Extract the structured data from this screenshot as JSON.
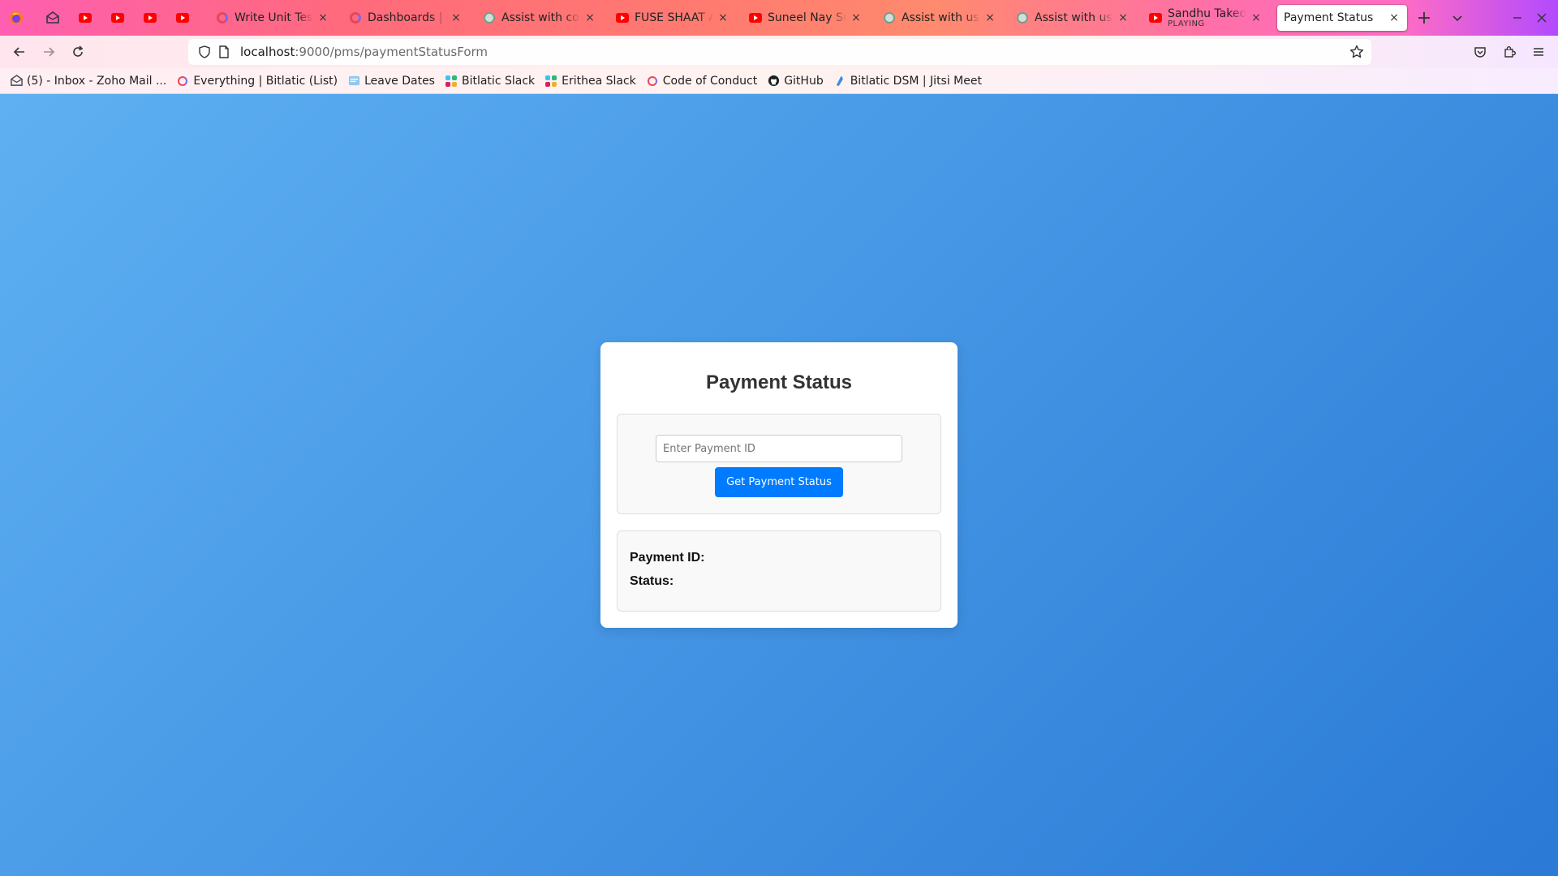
{
  "browser": {
    "tabs": [
      {
        "title": "Write Unit Tests",
        "icon": "clickup-icon"
      },
      {
        "title": "Dashboards | Bitlatic",
        "icon": "clickup-icon"
      },
      {
        "title": "Assist with conv",
        "icon": "chatgpt-icon"
      },
      {
        "title": "FUSE SHAAT AYE",
        "icon": "youtube-icon"
      },
      {
        "title": "Suneel Nay Sulel",
        "icon": "youtube-icon"
      },
      {
        "title": "Assist with user",
        "icon": "chatgpt-icon"
      },
      {
        "title": "Assist with user",
        "icon": "chatgpt-icon"
      },
      {
        "title": "Sandhu Takeover",
        "subtitle": "PLAYING",
        "icon": "youtube-icon"
      },
      {
        "title": "Payment Status",
        "icon": "none",
        "active": true
      }
    ],
    "close_glyph": "×",
    "new_tab_glyph": "+",
    "url": {
      "host": "localhost",
      "path": ":9000/pms/paymentStatusForm"
    },
    "bookmarks": [
      {
        "label": "(5) - Inbox - Zoho Mail ...",
        "icon": "zoho-mail-icon"
      },
      {
        "label": "Everything | Bitlatic (List)",
        "icon": "clickup-icon"
      },
      {
        "label": "Leave Dates",
        "icon": "sheet-icon"
      },
      {
        "label": "Bitlatic Slack",
        "icon": "slack-icon"
      },
      {
        "label": "Erithea Slack",
        "icon": "slack-icon"
      },
      {
        "label": "Code of Conduct",
        "icon": "clickup-icon"
      },
      {
        "label": "GitHub",
        "icon": "github-icon"
      },
      {
        "label": "Bitlatic DSM | Jitsi Meet",
        "icon": "jitsi-icon"
      }
    ]
  },
  "page": {
    "title": "Payment Status",
    "input_placeholder": "Enter Payment ID",
    "input_value": "",
    "button_label": "Get Payment Status",
    "result": {
      "payment_id_label": "Payment ID:",
      "payment_id_value": "",
      "status_label": "Status:",
      "status_value": ""
    }
  },
  "colors": {
    "button": "#007bff",
    "background_start": "#5eb0f2",
    "background_end": "#2a7ad6"
  }
}
